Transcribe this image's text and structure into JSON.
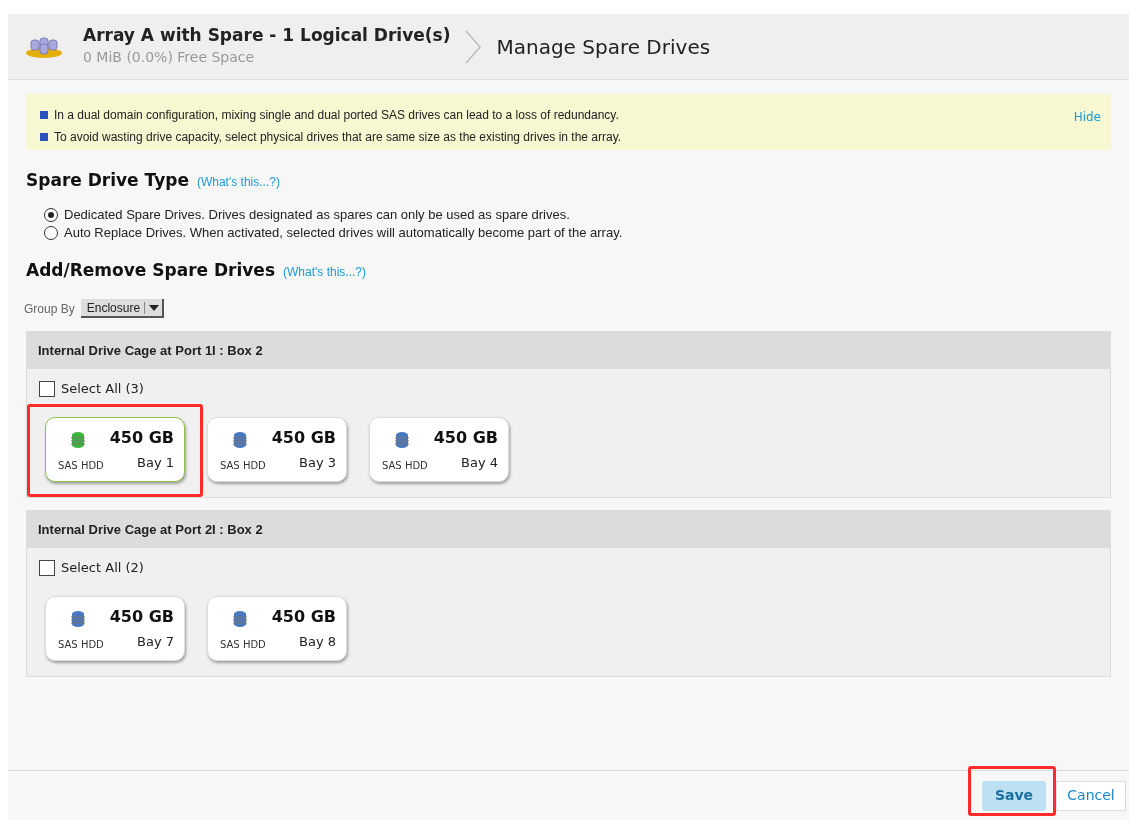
{
  "header": {
    "title": "Array A with Spare - 1 Logical Drive(s)",
    "subtitle": "0 MiB (0.0%) Free Space",
    "page_title": "Manage Spare Drives"
  },
  "notice": {
    "messages": [
      "In a dual domain configuration, mixing single and dual ported SAS drives can lead to a loss of redundancy.",
      "To avoid wasting drive capacity, select physical drives that are same size as the existing drives in the array."
    ],
    "hide_link": "Hide"
  },
  "spare_type": {
    "heading": "Spare Drive Type",
    "help_link": "(What's this...?)",
    "options": [
      {
        "label": "Dedicated Spare Drives. Drives designated as spares can only be used as spare drives.",
        "selected": true
      },
      {
        "label": "Auto Replace Drives. When activated, selected drives will automatically become part of the array.",
        "selected": false
      }
    ]
  },
  "add_remove": {
    "heading": "Add/Remove Spare Drives",
    "help_link": "(What's this...?)",
    "group_by_label": "Group By",
    "group_by_value": "Enclosure"
  },
  "groups": [
    {
      "title": "Internal Drive Cage at Port 1I : Box 2",
      "select_all": "Select All (3)",
      "checked": false,
      "drives": [
        {
          "size": "450 GB",
          "type": "SAS HDD",
          "bay": "Bay 1",
          "selected": true,
          "highlighted": true
        },
        {
          "size": "450 GB",
          "type": "SAS HDD",
          "bay": "Bay 3",
          "selected": false,
          "highlighted": false
        },
        {
          "size": "450 GB",
          "type": "SAS HDD",
          "bay": "Bay 4",
          "selected": false,
          "highlighted": false
        }
      ]
    },
    {
      "title": "Internal Drive Cage at Port 2I : Box 2",
      "select_all": "Select All (2)",
      "checked": false,
      "drives": [
        {
          "size": "450 GB",
          "type": "SAS HDD",
          "bay": "Bay 7",
          "selected": false,
          "highlighted": false
        },
        {
          "size": "450 GB",
          "type": "SAS HDD",
          "bay": "Bay 8",
          "selected": false,
          "highlighted": false
        }
      ]
    }
  ],
  "footer": {
    "save": "Save",
    "save_highlighted": true,
    "cancel": "Cancel"
  }
}
